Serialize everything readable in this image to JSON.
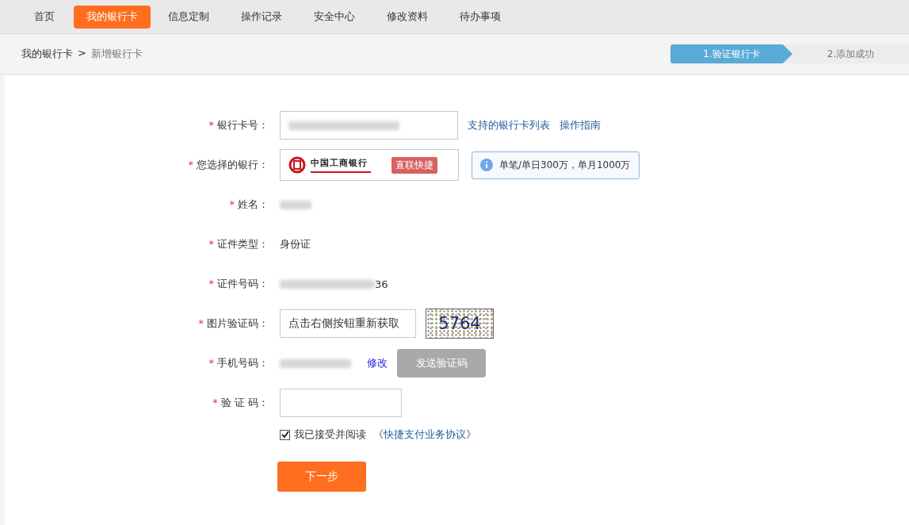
{
  "nav": {
    "tabs": [
      {
        "label": "首页",
        "selected": false
      },
      {
        "label": "我的银行卡",
        "selected": true
      },
      {
        "label": "信息定制",
        "selected": false
      },
      {
        "label": "操作记录",
        "selected": false
      },
      {
        "label": "安全中心",
        "selected": false
      },
      {
        "label": "修改资料",
        "selected": false
      },
      {
        "label": "待办事项",
        "selected": false
      }
    ]
  },
  "breadcrumb": {
    "parent": "我的银行卡",
    "separator": ">",
    "current": "新增银行卡"
  },
  "steps": [
    {
      "label": "1.验证银行卡",
      "selected": true
    },
    {
      "label": "2.添加成功",
      "selected": false
    }
  ],
  "form": {
    "fields": [
      {
        "kind": "card",
        "label": "银行卡号：",
        "required_mark": "*",
        "links": [
          "支持的银行卡列表",
          "操作指南"
        ]
      },
      {
        "kind": "bank",
        "label": "您选择的银行：",
        "required_mark": "*",
        "bank_name": "中国工商银行",
        "badge": "直联快捷",
        "tip": "单笔/单日300万，单月1000万"
      },
      {
        "kind": "redacted",
        "label": "姓名：",
        "required_mark": "*"
      },
      {
        "kind": "text",
        "label": "证件类型：",
        "required_mark": "*",
        "value": "身份证"
      },
      {
        "kind": "redacted",
        "label": "证件号码：",
        "required_mark": "*",
        "suffix": "36"
      },
      {
        "kind": "captcha",
        "label": "图片验证码：",
        "required_mark": "*",
        "value": "点击右侧按钮重新获取",
        "captcha": "5764"
      },
      {
        "kind": "phone",
        "label": "手机号码：",
        "required_mark": "*",
        "link": "修改",
        "button": "发送验证码",
        "button_disabled": true
      },
      {
        "kind": "code",
        "label": "验 证 码：",
        "required_mark": "*"
      }
    ],
    "agreement": {
      "checked": true,
      "text": "我已接受并阅读",
      "link": "《快捷支付业务协议》"
    },
    "submit": "下一步"
  }
}
